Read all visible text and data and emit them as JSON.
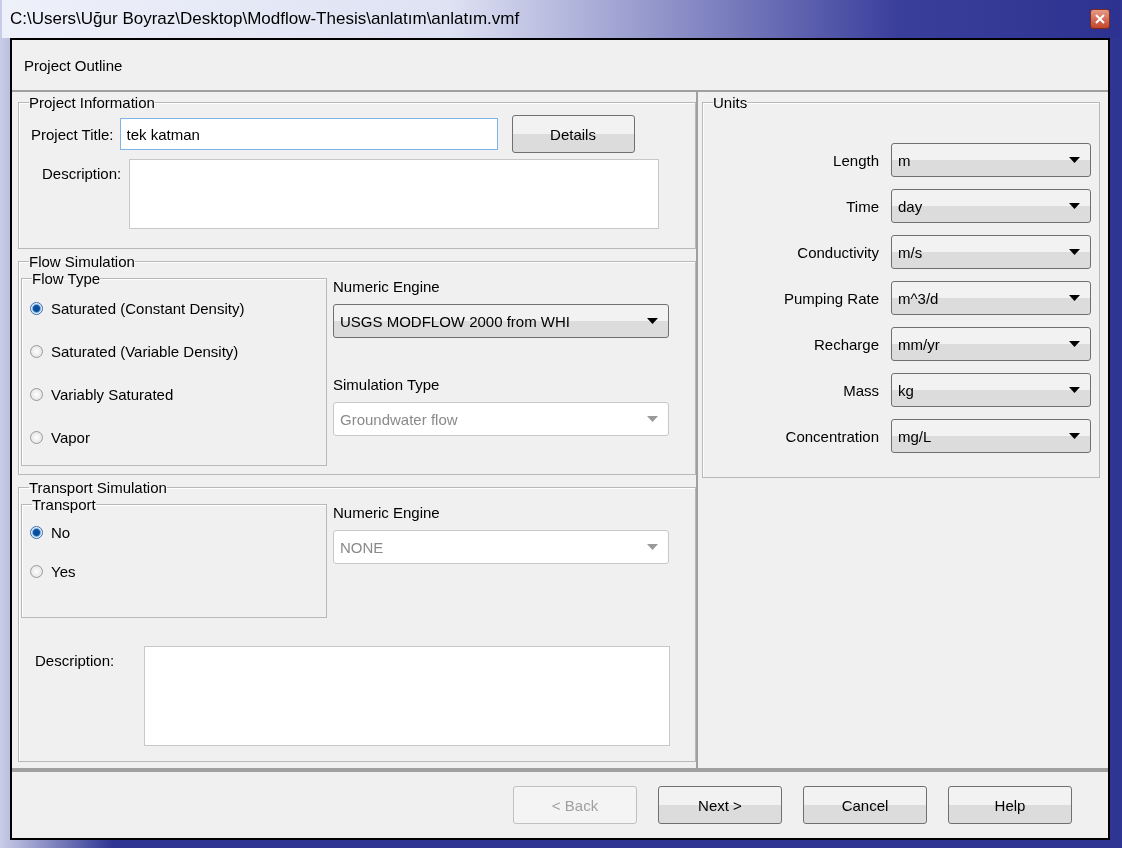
{
  "window": {
    "title": "C:\\Users\\Uğur Boyraz\\Desktop\\Modflow-Thesis\\anlatım\\anlatım.vmf"
  },
  "header": {
    "title": "Project Outline"
  },
  "project_information": {
    "legend": "Project Information",
    "title_label": "Project Title:",
    "title_value": "tek katman",
    "details_button": {
      "label": "Details",
      "disabled": false
    },
    "description_label": "Description:"
  },
  "flow_simulation": {
    "legend": "Flow Simulation",
    "flow_type": {
      "legend": "Flow Type",
      "options": [
        {
          "label": "Saturated (Constant Density)",
          "selected": true
        },
        {
          "label": "Saturated (Variable Density)",
          "selected": false
        },
        {
          "label": "Variably Saturated",
          "selected": false
        },
        {
          "label": "Vapor",
          "selected": false
        }
      ]
    },
    "numeric_engine": {
      "label": "Numeric Engine",
      "value": "USGS MODFLOW 2000 from WHI",
      "disabled": false
    },
    "simulation_type": {
      "label": "Simulation Type",
      "value": "Groundwater flow",
      "disabled": true
    }
  },
  "transport_simulation": {
    "legend": "Transport Simulation",
    "transport": {
      "legend": "Transport",
      "options": [
        {
          "label": "No",
          "selected": true
        },
        {
          "label": "Yes",
          "selected": false
        }
      ]
    },
    "numeric_engine": {
      "label": "Numeric Engine",
      "value": "NONE",
      "disabled": true
    },
    "description_label": "Description:"
  },
  "units": {
    "legend": "Units",
    "rows": [
      {
        "label": "Length",
        "value": "m"
      },
      {
        "label": "Time",
        "value": "day"
      },
      {
        "label": "Conductivity",
        "value": "m/s"
      },
      {
        "label": "Pumping Rate",
        "value": "m^3/d"
      },
      {
        "label": "Recharge",
        "value": "mm/yr"
      },
      {
        "label": "Mass",
        "value": "kg"
      },
      {
        "label": "Concentration",
        "value": "mg/L"
      }
    ]
  },
  "buttons": [
    {
      "label": "< Back",
      "disabled": true
    },
    {
      "label": "Next >",
      "disabled": false
    },
    {
      "label": "Cancel",
      "disabled": false
    },
    {
      "label": "Help",
      "disabled": false
    }
  ]
}
